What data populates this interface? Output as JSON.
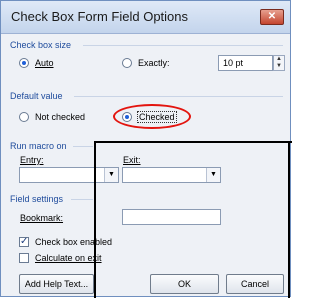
{
  "window": {
    "title": "Check Box Form Field Options",
    "close_label": "✕"
  },
  "size": {
    "heading": "Check box size",
    "auto_label": "Auto",
    "exactly_label": "Exactly:",
    "value": "10 pt",
    "selected": "auto"
  },
  "default_value": {
    "heading": "Default value",
    "not_checked_label": "Not checked",
    "checked_label": "Checked",
    "selected": "checked"
  },
  "run_macro": {
    "heading": "Run macro on",
    "entry_label": "Entry:",
    "exit_label": "Exit:",
    "entry_value": "",
    "exit_value": ""
  },
  "field_settings": {
    "heading": "Field settings",
    "bookmark_label": "Bookmark:",
    "bookmark_value": "",
    "check_enabled_label": "Check box enabled",
    "check_enabled": true,
    "calculate_label": "Calculate on exit",
    "calculate": false
  },
  "buttons": {
    "help_text_label": "Add Help Text...",
    "ok_label": "OK",
    "cancel_label": "Cancel"
  },
  "annotation": {
    "color": "#e3140e"
  }
}
